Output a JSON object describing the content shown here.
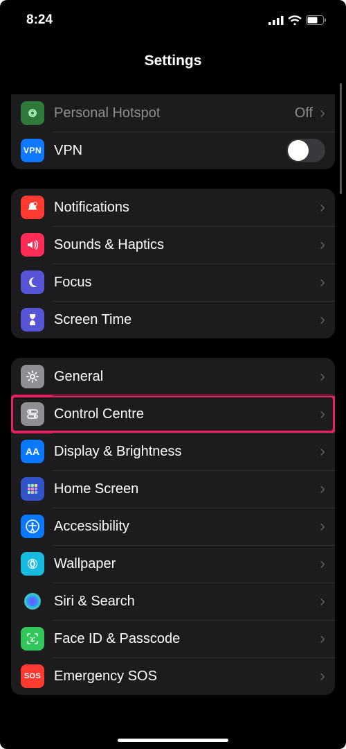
{
  "status": {
    "time": "8:24"
  },
  "header": {
    "title": "Settings"
  },
  "group1": {
    "hotspot": {
      "label": "Personal Hotspot",
      "value": "Off"
    },
    "vpn": {
      "label": "VPN",
      "badge": "VPN"
    }
  },
  "group2": {
    "notifications": "Notifications",
    "sounds": "Sounds & Haptics",
    "focus": "Focus",
    "screentime": "Screen Time"
  },
  "group3": {
    "general": "General",
    "control": "Control Centre",
    "display": "Display & Brightness",
    "home": "Home Screen",
    "accessibility": "Accessibility",
    "wallpaper": "Wallpaper",
    "siri": "Siri & Search",
    "faceid": "Face ID & Passcode",
    "sos": "Emergency SOS",
    "sos_badge": "SOS"
  },
  "text": {
    "aa": "AA"
  },
  "colors": {
    "highlight": "#e91e63"
  }
}
